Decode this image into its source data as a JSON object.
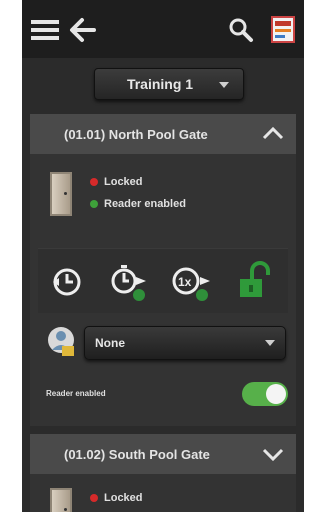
{
  "topbar": {
    "icons": [
      "menu-icon",
      "back-arrow-icon",
      "search-icon",
      "app-icon"
    ]
  },
  "site_selector": {
    "value": "Training 1"
  },
  "doors": [
    {
      "title": "(01.01) North Pool Gate",
      "expanded": true,
      "status_lock": "Locked",
      "status_reader": "Reader enabled",
      "mode_value": "None",
      "reader_toggle_label": "Reader enabled",
      "reader_toggle_on": true
    },
    {
      "title": "(01.02) South Pool Gate",
      "expanded": false,
      "status_lock": "Locked"
    }
  ],
  "colors": {
    "background": "#2b2b2b",
    "header": "#1e1e1e",
    "panel_header": "#4a4a4a",
    "accent_green": "#57b04a",
    "locked_red": "#d62a2a",
    "enabled_green": "#3ea13a"
  }
}
